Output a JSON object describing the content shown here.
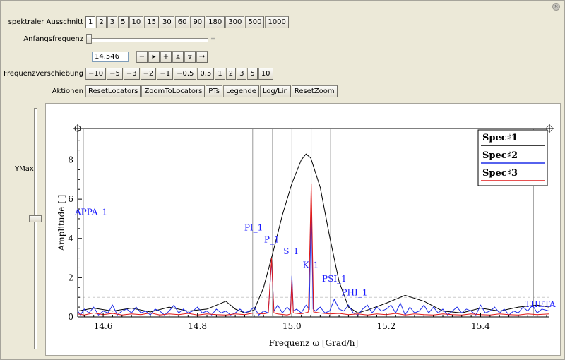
{
  "window": {
    "close_glyph": "×"
  },
  "controls": {
    "spectral_label": "spektraler Ausschnitt",
    "spectral_buttons": [
      "1",
      "2",
      "3",
      "5",
      "10",
      "15",
      "30",
      "60",
      "90",
      "180",
      "300",
      "500",
      "1000"
    ],
    "spectral_selected": "1",
    "start_freq_label": "Anfangsfrequenz",
    "start_freq_slider_marker": "=",
    "start_freq_slider_position": 0.0,
    "start_freq_value": "14.546",
    "stepper_buttons": [
      "−",
      "▸",
      "+",
      "⩓",
      "⩔",
      "→"
    ],
    "shift_label": "Frequenzverschiebung",
    "shift_buttons": [
      "−10",
      "−5",
      "−3",
      "−2",
      "−1",
      "−0.5",
      "0.5",
      "1",
      "2",
      "3",
      "5",
      "10"
    ],
    "actions_label": "Aktionen",
    "action_buttons": [
      "ResetLocators",
      "ZoomToLocators",
      "PTs",
      "Legende",
      "Log/Lin",
      "ResetZoom"
    ],
    "ymax_label": "YMax",
    "ymax_slider_position": 0.46
  },
  "colors": {
    "spec1": "#000000",
    "spec2": "#1f2ee8",
    "spec3": "#e01818",
    "labels": "#1a1aff",
    "vlines": "#808080"
  },
  "chart_data": {
    "type": "line",
    "title": "",
    "xlabel": "Frequenz ω [Grad/h]",
    "ylabel": "Amplitude [ ]",
    "xlim": [
      14.546,
      15.546
    ],
    "ylim": [
      0,
      9.6
    ],
    "xticks": [
      "14.6",
      "14.8",
      "15.0",
      "15.2",
      "15.4"
    ],
    "xtick_values": [
      14.6,
      14.8,
      15.0,
      15.2,
      15.4
    ],
    "yticks": [
      "0",
      "2",
      "4",
      "6",
      "8"
    ],
    "ytick_values": [
      0,
      2,
      4,
      6,
      8
    ],
    "legend_position": "top-right",
    "series": [
      {
        "name": "Spec♯1",
        "color": "#000000",
        "x": [
          14.546,
          14.58,
          14.62,
          14.66,
          14.7,
          14.74,
          14.78,
          14.82,
          14.86,
          14.88,
          14.9,
          14.92,
          14.94,
          14.96,
          14.98,
          15.0,
          15.02,
          15.03,
          15.04,
          15.06,
          15.08,
          15.1,
          15.12,
          15.14,
          15.16,
          15.2,
          15.24,
          15.28,
          15.32,
          15.36,
          15.4,
          15.44,
          15.48,
          15.52,
          15.546
        ],
        "y": [
          0.3,
          0.45,
          0.3,
          0.45,
          0.25,
          0.5,
          0.3,
          0.4,
          0.8,
          0.4,
          0.2,
          0.35,
          1.5,
          3.3,
          5.2,
          6.8,
          8.0,
          8.3,
          8.1,
          6.6,
          4.1,
          1.8,
          0.5,
          0.2,
          0.35,
          0.7,
          1.1,
          0.8,
          0.3,
          0.2,
          0.45,
          0.3,
          0.5,
          0.6,
          0.5
        ]
      },
      {
        "name": "Spec♯2",
        "color": "#1f2ee8",
        "x": [
          14.546,
          14.552,
          14.56,
          14.57,
          14.58,
          14.59,
          14.6,
          14.61,
          14.62,
          14.63,
          14.64,
          14.65,
          14.66,
          14.67,
          14.68,
          14.69,
          14.7,
          14.71,
          14.72,
          14.73,
          14.74,
          14.75,
          14.76,
          14.77,
          14.78,
          14.79,
          14.8,
          14.81,
          14.82,
          14.83,
          14.84,
          14.85,
          14.86,
          14.87,
          14.88,
          14.89,
          14.9,
          14.91,
          14.92,
          14.93,
          14.94,
          14.95,
          14.957,
          14.962,
          14.97,
          14.98,
          14.99,
          14.997,
          15.0,
          15.003,
          15.01,
          15.02,
          15.03,
          15.037,
          15.041,
          15.045,
          15.05,
          15.06,
          15.07,
          15.08,
          15.09,
          15.1,
          15.11,
          15.12,
          15.13,
          15.14,
          15.15,
          15.16,
          15.17,
          15.18,
          15.19,
          15.2,
          15.21,
          15.22,
          15.23,
          15.24,
          15.25,
          15.26,
          15.27,
          15.28,
          15.29,
          15.3,
          15.31,
          15.32,
          15.33,
          15.34,
          15.35,
          15.36,
          15.37,
          15.38,
          15.39,
          15.4,
          15.41,
          15.42,
          15.43,
          15.44,
          15.45,
          15.46,
          15.47,
          15.48,
          15.49,
          15.5,
          15.51,
          15.52,
          15.53,
          15.546
        ],
        "y": [
          0.3,
          0.1,
          0.4,
          0.2,
          0.5,
          0.1,
          0.3,
          0.2,
          0.6,
          0.1,
          0.3,
          0.4,
          0.2,
          0.5,
          0.2,
          0.3,
          0.1,
          0.4,
          0.3,
          0.1,
          0.3,
          0.6,
          0.2,
          0.4,
          0.2,
          0.3,
          0.5,
          0.2,
          0.3,
          0.1,
          0.4,
          0.2,
          0.3,
          0.1,
          0.2,
          0.4,
          0.2,
          0.3,
          0.5,
          0.1,
          0.3,
          0.2,
          2.9,
          0.3,
          0.6,
          0.2,
          0.5,
          0.3,
          2.1,
          0.3,
          0.4,
          0.2,
          0.6,
          0.4,
          6.0,
          0.4,
          0.3,
          0.5,
          0.2,
          0.3,
          0.9,
          0.4,
          0.3,
          0.6,
          0.2,
          0.1,
          0.4,
          0.6,
          0.2,
          0.5,
          0.3,
          0.4,
          0.6,
          0.2,
          0.7,
          0.1,
          0.5,
          0.2,
          0.3,
          0.6,
          0.2,
          0.5,
          0.2,
          0.4,
          0.1,
          0.3,
          0.5,
          0.2,
          0.4,
          0.3,
          0.1,
          0.6,
          0.2,
          0.3,
          0.5,
          0.2,
          0.4,
          0.1,
          0.3,
          0.2,
          0.5,
          0.3,
          0.6,
          0.2,
          0.4,
          0.3
        ]
      },
      {
        "name": "Spec♯3",
        "color": "#e01818",
        "x": [
          14.546,
          14.56,
          14.58,
          14.6,
          14.62,
          14.64,
          14.66,
          14.68,
          14.7,
          14.72,
          14.74,
          14.76,
          14.78,
          14.8,
          14.82,
          14.84,
          14.86,
          14.88,
          14.9,
          14.92,
          14.94,
          14.95,
          14.957,
          14.962,
          14.97,
          14.99,
          14.997,
          15.0,
          15.003,
          15.02,
          15.035,
          15.041,
          15.046,
          15.06,
          15.08,
          15.1,
          15.12,
          15.14,
          15.16,
          15.18,
          15.2,
          15.22,
          15.24,
          15.26,
          15.28,
          15.3,
          15.32,
          15.34,
          15.36,
          15.38,
          15.4,
          15.42,
          15.44,
          15.46,
          15.48,
          15.5,
          15.52,
          15.546
        ],
        "y": [
          0.15,
          0.1,
          0.2,
          0.12,
          0.18,
          0.1,
          0.15,
          0.12,
          0.2,
          0.1,
          0.15,
          0.12,
          0.18,
          0.1,
          0.15,
          0.12,
          0.1,
          0.15,
          0.12,
          0.2,
          0.15,
          0.2,
          3.0,
          0.2,
          0.15,
          0.1,
          0.15,
          1.9,
          0.2,
          0.15,
          0.25,
          6.8,
          0.25,
          0.2,
          0.15,
          0.18,
          0.12,
          0.15,
          0.1,
          0.15,
          0.12,
          0.18,
          0.1,
          0.15,
          0.12,
          0.1,
          0.15,
          0.12,
          0.1,
          0.15,
          0.12,
          0.1,
          0.15,
          0.12,
          0.1,
          0.15,
          0.12,
          0.15
        ]
      }
    ],
    "reference_line_y": 1.0,
    "markers": [
      {
        "label": "APPA_1",
        "x": 14.558,
        "label_y": 5.2
      },
      {
        "label": "PI_1",
        "x": 14.917,
        "label_y": 4.4
      },
      {
        "label": "P_1",
        "x": 14.959,
        "label_y": 3.8
      },
      {
        "label": "S_1",
        "x": 15.0,
        "label_y": 3.2
      },
      {
        "label": "K_1",
        "x": 15.041,
        "label_y": 2.5
      },
      {
        "label": "PSI_1",
        "x": 15.082,
        "label_y": 1.8
      },
      {
        "label": "PHI_1",
        "x": 15.123,
        "label_y": 1.1
      },
      {
        "label": "THETA",
        "x": 15.512,
        "label_y": 0.5
      }
    ]
  }
}
